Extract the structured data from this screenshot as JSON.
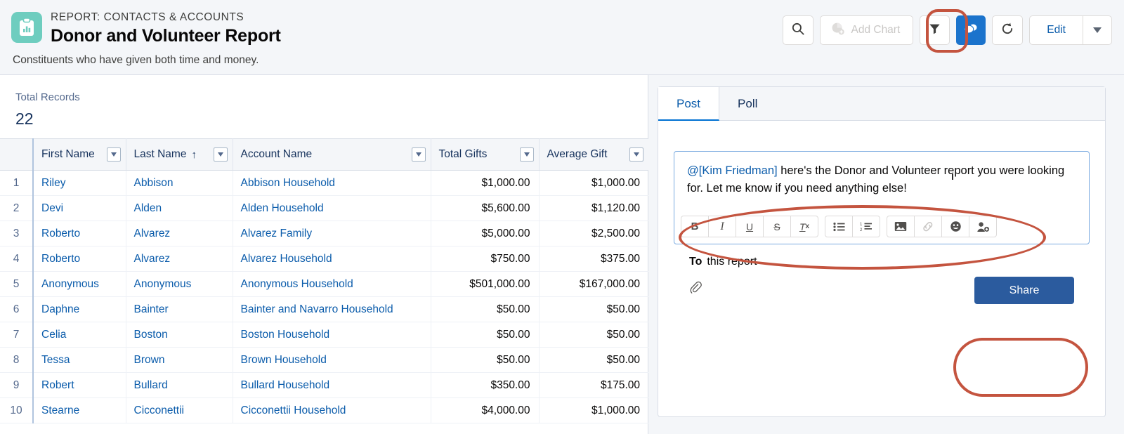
{
  "header": {
    "eyebrow": "REPORT: CONTACTS & ACCOUNTS",
    "title": "Donor and Volunteer Report",
    "subtitle": "Constituents who have given both time and money.",
    "icon_name": "report-clipboard-chart-icon",
    "icon_color": "#6ecdbf"
  },
  "toolbar": {
    "search_icon": "search-icon",
    "add_chart_label": "Add Chart",
    "add_chart_icon": "pie-chart-add-icon",
    "filter_icon": "filter-funnel-icon",
    "chatter_icon": "chatter-speech-bubble-icon",
    "refresh_icon": "refresh-icon",
    "edit_label": "Edit",
    "edit_caret_icon": "chevron-down-icon",
    "highlight_color": "#c4543f",
    "chatter_active_color": "#1b73cc"
  },
  "report": {
    "totals_label": "Total Records",
    "totals_value": "22",
    "columns": [
      {
        "label": "First Name",
        "sorted": false,
        "align": "left"
      },
      {
        "label": "Last Name",
        "sorted": true,
        "sort_glyph": "↑",
        "align": "left"
      },
      {
        "label": "Account Name",
        "sorted": false,
        "align": "left"
      },
      {
        "label": "Total Gifts",
        "sorted": false,
        "align": "right"
      },
      {
        "label": "Average Gift",
        "sorted": false,
        "align": "right"
      }
    ],
    "rows": [
      {
        "n": "1",
        "first": "Riley",
        "last": "Abbison",
        "account": "Abbison Household",
        "total": "$1,000.00",
        "average": "$1,000.00"
      },
      {
        "n": "2",
        "first": "Devi",
        "last": "Alden",
        "account": "Alden Household",
        "total": "$5,600.00",
        "average": "$1,120.00"
      },
      {
        "n": "3",
        "first": "Roberto",
        "last": "Alvarez",
        "account": "Alvarez Family",
        "total": "$5,000.00",
        "average": "$2,500.00"
      },
      {
        "n": "4",
        "first": "Roberto",
        "last": "Alvarez",
        "account": "Alvarez Household",
        "total": "$750.00",
        "average": "$375.00"
      },
      {
        "n": "5",
        "first": "Anonymous",
        "last": "Anonymous",
        "account": "Anonymous Household",
        "total": "$501,000.00",
        "average": "$167,000.00"
      },
      {
        "n": "6",
        "first": "Daphne",
        "last": "Bainter",
        "account": "Bainter and Navarro Household",
        "total": "$50.00",
        "average": "$50.00"
      },
      {
        "n": "7",
        "first": "Celia",
        "last": "Boston",
        "account": "Boston Household",
        "total": "$50.00",
        "average": "$50.00"
      },
      {
        "n": "8",
        "first": "Tessa",
        "last": "Brown",
        "account": "Brown Household",
        "total": "$50.00",
        "average": "$50.00"
      },
      {
        "n": "9",
        "first": "Robert",
        "last": "Bullard",
        "account": "Bullard Household",
        "total": "$350.00",
        "average": "$175.00"
      },
      {
        "n": "10",
        "first": "Stearne",
        "last": "Cicconettii",
        "account": "Cicconettii Household",
        "total": "$4,000.00",
        "average": "$1,000.00"
      }
    ]
  },
  "publisher": {
    "tabs": [
      {
        "label": "Post",
        "active": true
      },
      {
        "label": "Poll",
        "active": false
      }
    ],
    "post_mention": "@[Kim Friedman]",
    "post_body": " here's the Donor and Volunteer   report you were looking for. Let me know if you need anything else!",
    "format_buttons": [
      {
        "name": "bold-icon",
        "glyph": "B"
      },
      {
        "name": "italic-icon",
        "glyph": "I"
      },
      {
        "name": "underline-icon",
        "glyph": "U"
      },
      {
        "name": "strikethrough-icon",
        "glyph": "S"
      },
      {
        "name": "remove-format-icon",
        "glyph": "Tx"
      },
      {
        "name": "bulleted-list-icon",
        "glyph": "≡"
      },
      {
        "name": "numbered-list-icon",
        "glyph": "1≡"
      },
      {
        "name": "insert-image-icon",
        "glyph": "image"
      },
      {
        "name": "insert-link-icon",
        "glyph": "link"
      },
      {
        "name": "emoji-icon",
        "glyph": "emoji"
      },
      {
        "name": "mention-person-icon",
        "glyph": "person"
      }
    ],
    "to_label": "To",
    "to_value": "this report",
    "attach_icon": "paperclip-icon",
    "share_label": "Share",
    "share_color": "#2b5b9e"
  }
}
